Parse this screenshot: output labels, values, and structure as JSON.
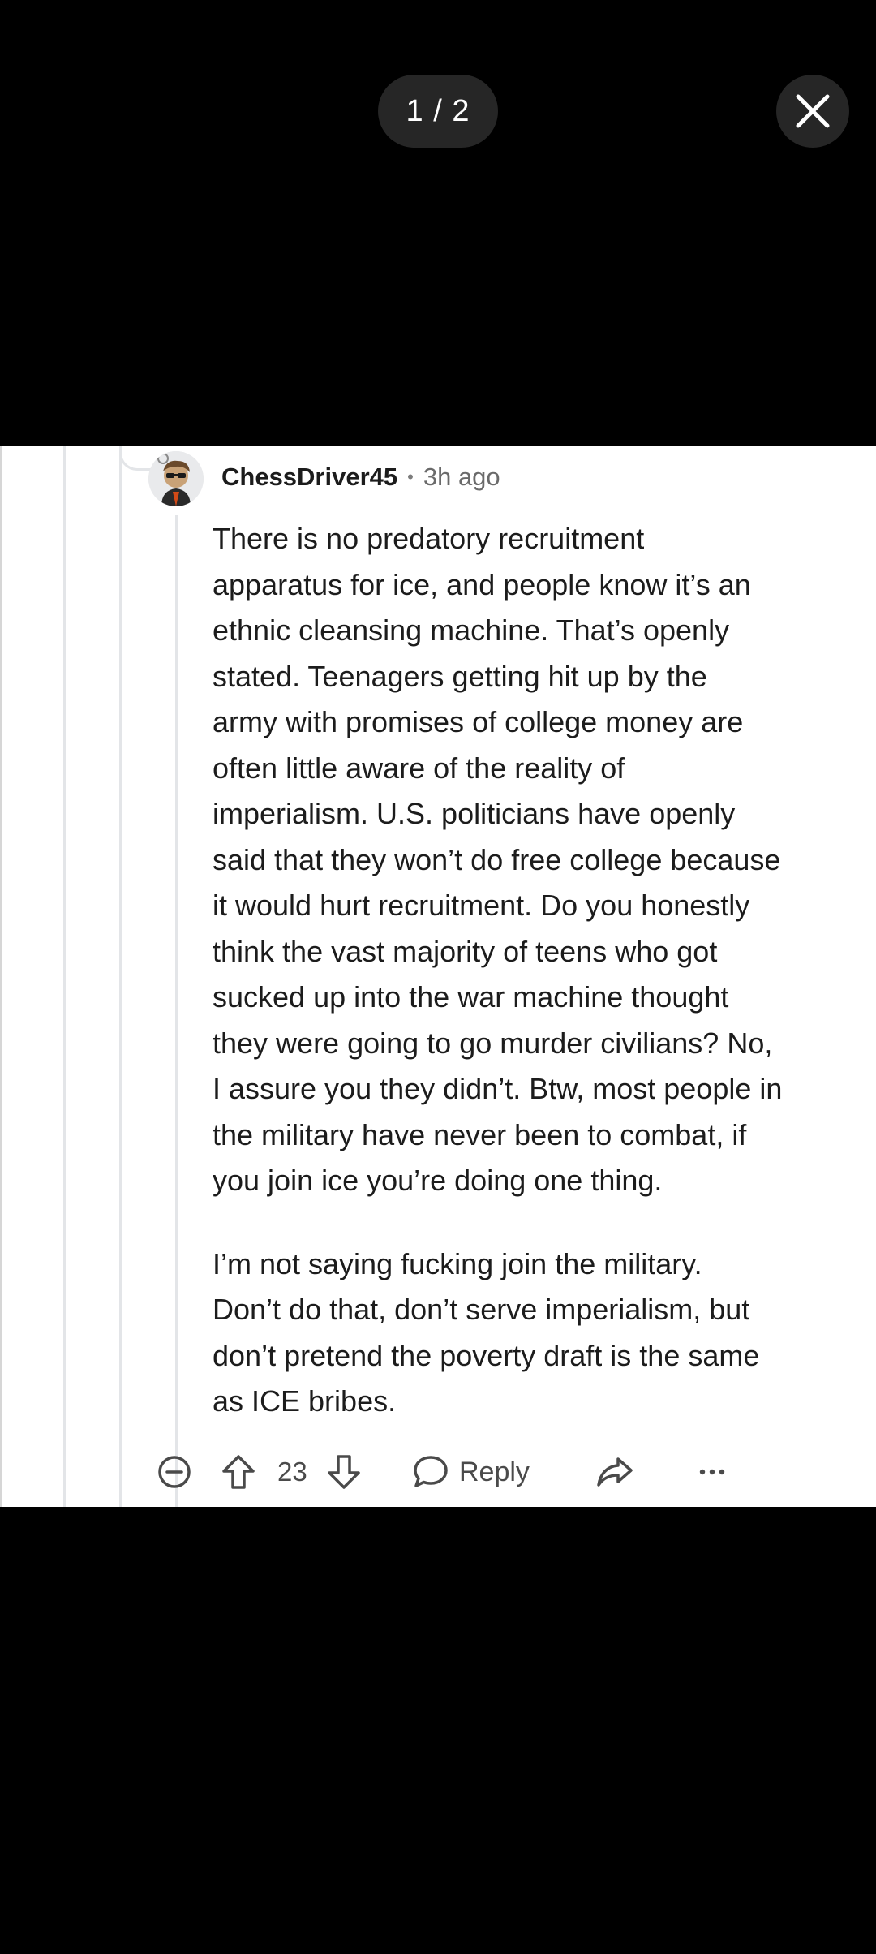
{
  "viewer": {
    "page_counter": "1 / 2",
    "close_icon": "close-icon"
  },
  "comment": {
    "username": "ChessDriver45",
    "separator": "•",
    "timestamp": "3h ago",
    "avatar_icon": "avatar-icon",
    "paragraphs": [
      "There is no predatory recruitment\napparatus for ice, and people know it’s an\nethnic cleansing machine. That’s openly\nstated. Teenagers getting hit up by the\narmy with promises of college money are\noften little aware of the reality of\nimperialism. U.S. politicians have openly\nsaid that they won’t do free college because\nit would hurt recruitment. Do you honestly\nthink the vast majority of teens who got\nsucked up into the war machine thought\nthey were going to go murder civilians? No,\nI assure you they didn’t. Btw, most people in\nthe military have never been to combat, if\nyou join ice you’re doing one thing.",
      "I’m not saying fucking join the military.\nDon’t do that, don’t serve imperialism, but\ndon’t pretend the poverty draft is the same\nas ICE bribes."
    ],
    "score": "23",
    "reply_label": "Reply",
    "more_label": "···",
    "icons": {
      "collapse": "collapse-icon",
      "upvote": "upvote-icon",
      "downvote": "downvote-icon",
      "reply": "reply-icon",
      "share": "share-icon",
      "more": "more-icon"
    }
  }
}
